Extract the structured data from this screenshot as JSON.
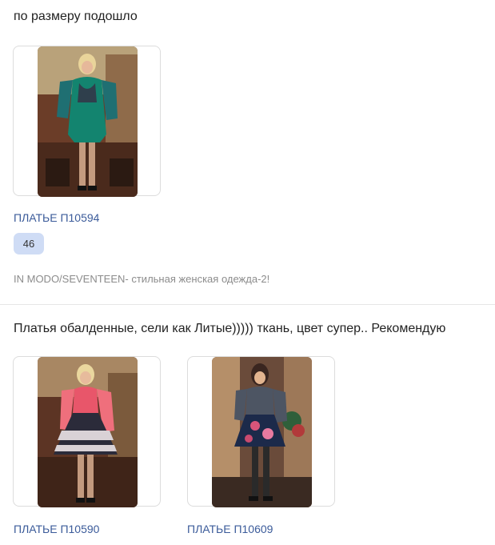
{
  "reviews": [
    {
      "text": "по размеру подошло",
      "products": [
        {
          "name": "ПЛАТЬЕ П10594",
          "photo": "photo-green-dress",
          "size": "46"
        }
      ],
      "store": "IN MODO/SEVENTEEN- стильная женская одежда-2!"
    },
    {
      "text": "Платья обалденные, сели как Литые))))) ткань, цвет супер.. Рекомендую",
      "products": [
        {
          "name": "ПЛАТЬЕ П10590",
          "photo": "photo-pattern-dress"
        },
        {
          "name": "ПЛАТЬЕ П10609",
          "photo": "photo-floral-dress"
        }
      ]
    }
  ],
  "colors": {
    "link": "#3b5b9a",
    "badge": "#cfdcf5",
    "muted": "#8c8c8c"
  }
}
